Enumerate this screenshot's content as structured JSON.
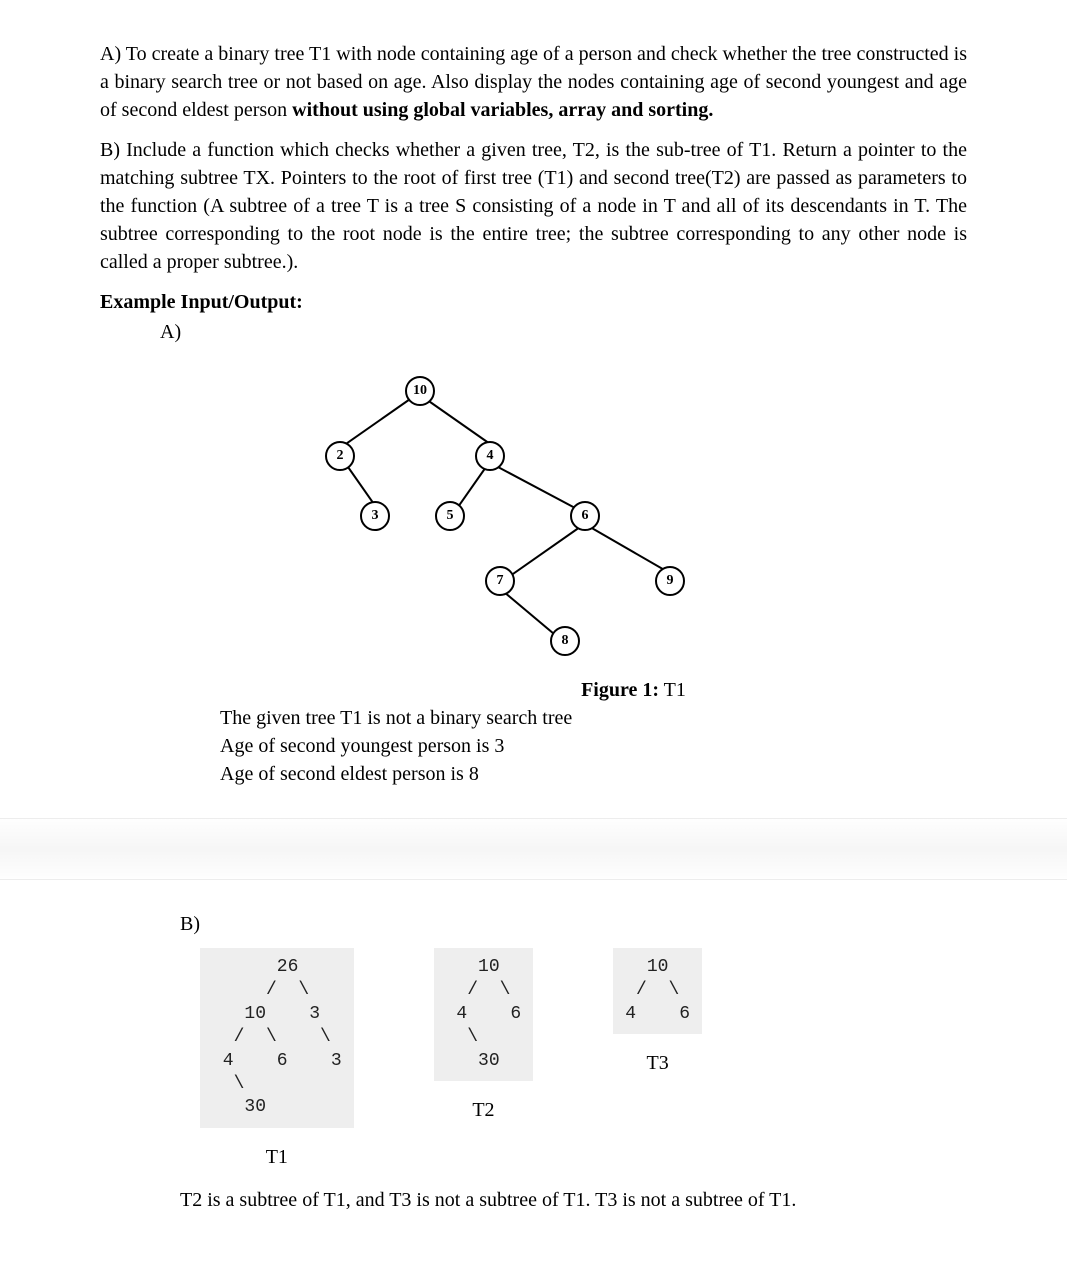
{
  "paraA": "A) To create a binary tree T1 with node containing age of a person and check whether the tree constructed is a binary search tree or not based on age. Also display the nodes containing age of second youngest and age of second eldest person ",
  "paraA_bold": "without using global variables, array and sorting.",
  "paraB": "B) Include a function which checks whether a given tree, T2, is the sub-tree of T1. Return a pointer to the matching subtree TX. Pointers to the root of first tree (T1) and second tree(T2) are passed as parameters to the function (A subtree of a tree T is a tree S consisting of a node in T and all of its descendants in T. The subtree corresponding to the root node is the entire tree; the subtree corresponding to any other node is called a proper subtree.).",
  "example_label": "Example Input/Output:",
  "example_A": "A)",
  "fig1": {
    "nodes": {
      "n10": "10",
      "n2": "2",
      "n4": "4",
      "n3": "3",
      "n5": "5",
      "n6": "6",
      "n7": "7",
      "n9": "9",
      "n8": "8"
    },
    "caption_bold": "Figure 1:",
    "caption_rest": " T1",
    "line1": "The given tree T1 is not a binary search tree",
    "line2": "Age of second youngest person is 3",
    "line3": "Age of second eldest person is 8"
  },
  "sectionB": {
    "label": "B)",
    "t1_ascii": "      26\n     /  \\\n   10    3\n  /  \\    \\\n 4    6    3\n  \\\n   30",
    "t2_ascii": "   10\n  /  \\\n 4    6\n  \\\n   30",
    "t3_ascii": "  10\n /  \\\n4    6",
    "t1_label": "T1",
    "t2_label": "T2",
    "t3_label": "T3",
    "conclusion": "T2 is a subtree of T1, and T3 is not a subtree of T1. T3 is not a subtree of T1."
  }
}
